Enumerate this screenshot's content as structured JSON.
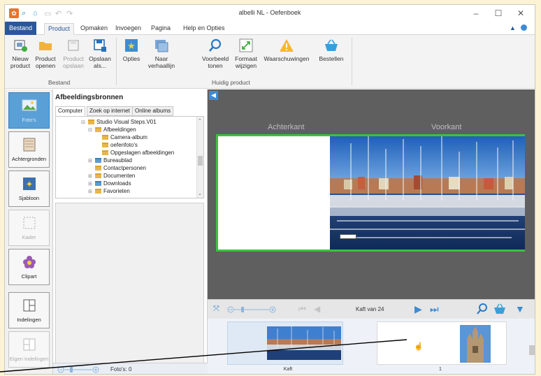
{
  "window": {
    "title": "albelli NL - Oefenboek"
  },
  "ribbon_tabs": [
    "Bestand",
    "Product",
    "Opmaken",
    "Invoegen",
    "Pagina",
    "Help en Opties"
  ],
  "ribbon": {
    "buttons": [
      {
        "label1": "Nieuw",
        "label2": "product",
        "disabled": false,
        "icon": "new-product-icon"
      },
      {
        "label1": "Product",
        "label2": "openen",
        "disabled": false,
        "icon": "folder-open-icon"
      },
      {
        "label1": "Product",
        "label2": "opslaan",
        "disabled": true,
        "icon": "save-icon"
      },
      {
        "label1": "Opslaan",
        "label2": "als...",
        "disabled": false,
        "icon": "save-as-icon"
      },
      {
        "label1": "Opties",
        "label2": "",
        "disabled": false,
        "icon": "options-star-icon"
      },
      {
        "label1": "Naar",
        "label2": "verhaallijn",
        "disabled": false,
        "icon": "storyline-icon"
      },
      {
        "label1": "Voorbeeld",
        "label2": "tonen",
        "disabled": false,
        "icon": "search-icon"
      },
      {
        "label1": "Formaat",
        "label2": "wijzigen",
        "disabled": false,
        "icon": "resize-icon"
      },
      {
        "label1": "Waarschuwingen",
        "label2": "",
        "disabled": false,
        "icon": "warning-icon"
      },
      {
        "label1": "Bestellen",
        "label2": "",
        "disabled": false,
        "icon": "basket-icon"
      }
    ],
    "groups": [
      "Bestand",
      "Huidig product"
    ]
  },
  "tools": [
    {
      "label": "Foto's",
      "active": true,
      "disabled": false,
      "icon": "photo-icon"
    },
    {
      "label": "Achtergronden",
      "active": false,
      "disabled": false,
      "icon": "backgrounds-icon"
    },
    {
      "label": "Sjabloon",
      "active": false,
      "disabled": false,
      "icon": "template-icon"
    },
    {
      "label": "Kader",
      "active": false,
      "disabled": true,
      "icon": "frame-icon"
    },
    {
      "label": "Clipart",
      "active": false,
      "disabled": false,
      "icon": "clipart-flower-icon"
    },
    {
      "label": "Indelingen",
      "active": false,
      "disabled": false,
      "icon": "layouts-icon"
    },
    {
      "label": "Eigen indelingen",
      "active": false,
      "disabled": true,
      "icon": "own-layouts-icon"
    }
  ],
  "sources": {
    "title": "Afbeeldingsbronnen",
    "tabs": [
      "Computer",
      "Zoek op internet",
      "Online albums"
    ],
    "tree": [
      "Studio Visual Steps.V01",
      "Afbeeldingen",
      "Camera-album",
      "oefenfoto's",
      "Opgeslagen afbeeldingen",
      "Bureaublad",
      "Contactpersonen",
      "Documenten",
      "Downloads",
      "Favorieten"
    ],
    "photo_count": "Foto's: 0"
  },
  "canvas": {
    "back_label": "Achterkant",
    "front_label": "Voorkant"
  },
  "navigator": {
    "page_text": "Kaft van 24"
  },
  "thumbnails": [
    {
      "label": "Kaft"
    },
    {
      "label": "1"
    }
  ],
  "colors": {
    "accent": "#2b579a",
    "cover_border": "#3fbf3f",
    "work_bg": "#5f5f5f",
    "nav_blue": "#3d8bd4"
  }
}
